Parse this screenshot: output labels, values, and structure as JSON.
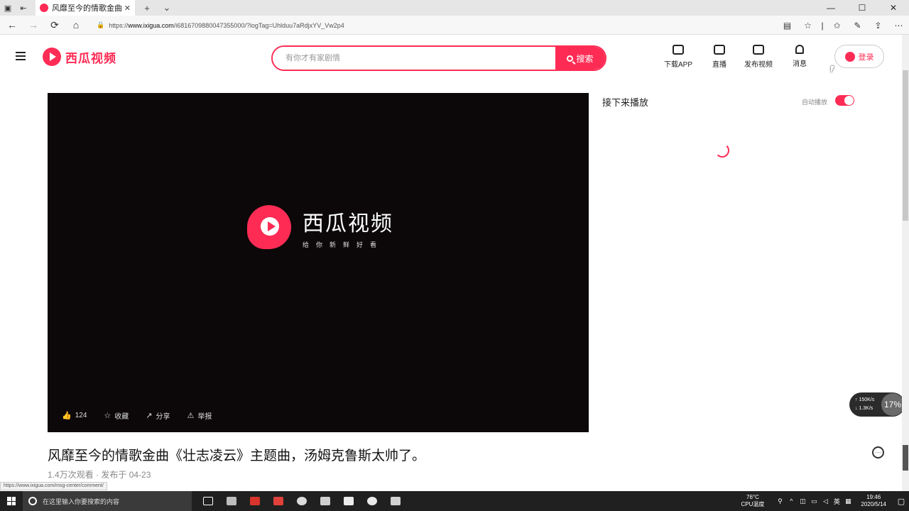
{
  "browser": {
    "tab_title": "风靡至今的情歌金曲《",
    "tab_close": "✕",
    "new_tab": "+",
    "url_prefix": "https://",
    "url_host": "www.ixigua.com",
    "url_path": "/i6816709880047355000/?logTag=Uhlduu7aRdjxYV_Vw2p4",
    "back": "←",
    "forward": "→",
    "refresh": "⟳",
    "home": "⌂",
    "minimize": "—",
    "maximize": "☐",
    "close": "✕"
  },
  "header": {
    "logo_text": "西瓜视频",
    "search_placeholder": "有你才有家剧情",
    "search_button": "搜索",
    "actions": [
      {
        "label": "下载APP",
        "icon": "download-icon"
      },
      {
        "label": "直播",
        "icon": "live-icon"
      },
      {
        "label": "发布视频",
        "icon": "upload-video-icon"
      },
      {
        "label": "消息",
        "icon": "bell-icon"
      }
    ],
    "login": "登录"
  },
  "player": {
    "logo_big": "西瓜视频",
    "logo_small": "给你新鲜好看",
    "actions": {
      "like_count": "124",
      "collect": "收藏",
      "share": "分享",
      "report": "举报"
    }
  },
  "sidebar": {
    "up_next": "接下来播放",
    "autoplay": "自动播放",
    "autoplay_on": true
  },
  "video": {
    "title": "风靡至今的情歌金曲《壮志凌云》主题曲，汤姆克鲁斯太帅了。",
    "views": "1.4万次观看",
    "dot": "·",
    "published": "发布于 04-23",
    "more": "···"
  },
  "status_link": "https://www.ixigua.com/msg-center/comment/",
  "monitor": {
    "up": "↑ 150K/s",
    "down": "↓ 1.3K/s",
    "percent": "17%"
  },
  "taskbar": {
    "search_placeholder": "在这里输入你要搜索的内容",
    "temperature": "76°C",
    "cpu": "CPU温度",
    "ime": "英",
    "time": "19:46",
    "date": "2020/5/14"
  },
  "colors": {
    "brand": "#fe2c55",
    "player_bg": "#0c0809",
    "taskbar": "#202020"
  }
}
